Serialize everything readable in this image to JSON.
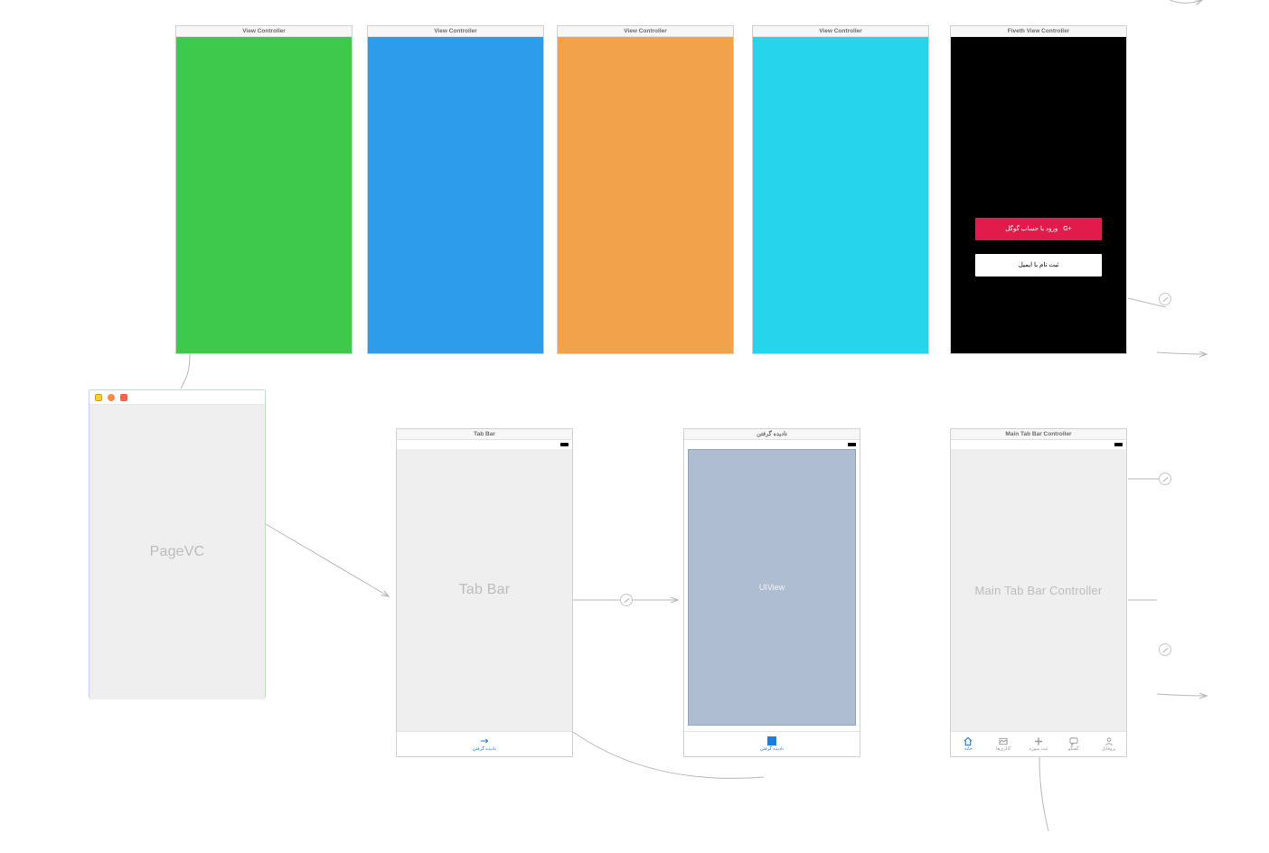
{
  "top_row": {
    "vc1": {
      "title": "View Controller"
    },
    "vc2": {
      "title": "View Controller"
    },
    "vc3": {
      "title": "View Controller"
    },
    "vc4": {
      "title": "View Controller"
    },
    "vc5": {
      "title": "Fiveth View Controller",
      "google_label": "ورود با حساب گوگل",
      "google_suffix": "G+",
      "email_label": "ثبت نام با ایمیل"
    }
  },
  "bottom_row": {
    "pagevc": {
      "placeholder": "PageVC"
    },
    "tabbar_scene": {
      "title": "Tab Bar",
      "placeholder": "Tab Bar",
      "tab_label": "نادیده گرفتن"
    },
    "uiview_scene": {
      "title": "نادیده گرفتن",
      "inner_label": "UIView",
      "tab_label": "نادیده گرفتن"
    },
    "maintab_scene": {
      "title": "Main Tab Bar Controller",
      "placeholder": "Main Tab Bar Controller",
      "tabs": [
        {
          "label": "خانه"
        },
        {
          "label": "گالری‌ها"
        },
        {
          "label": "ثبت سوژه"
        },
        {
          "label": "گفتگو"
        },
        {
          "label": "پروفایل"
        }
      ]
    }
  }
}
